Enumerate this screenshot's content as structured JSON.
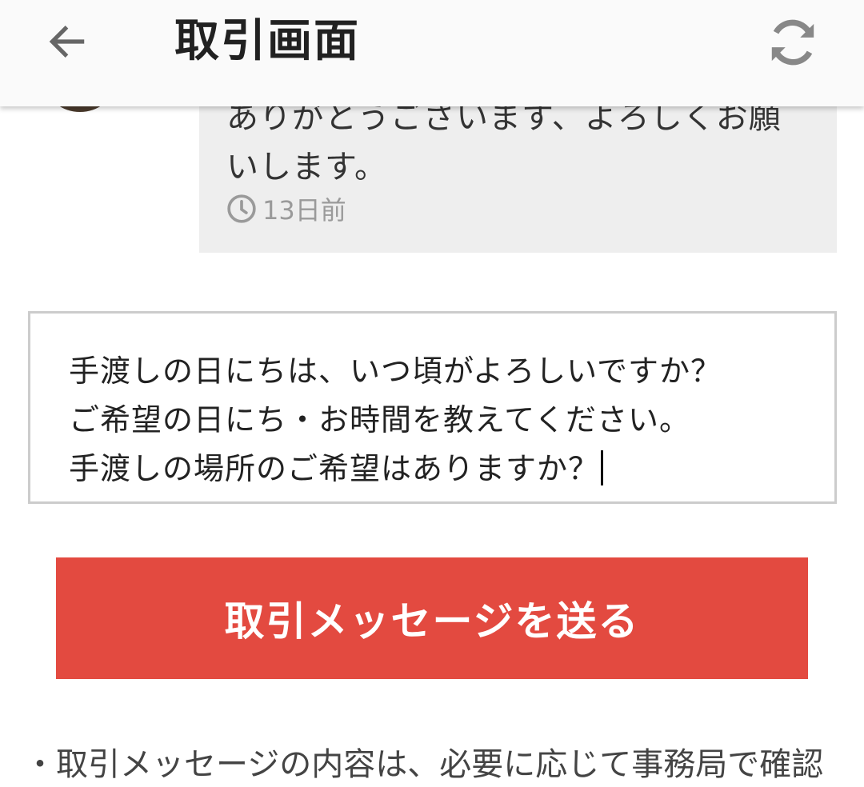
{
  "header": {
    "title": "取引画面",
    "back_icon": "arrow-left-icon",
    "refresh_icon": "refresh-icon"
  },
  "thread": {
    "messages": [
      {
        "text": "ありがとうございます、よろしくお願いします。",
        "time": "13日前",
        "time_icon": "clock-icon"
      }
    ]
  },
  "compose": {
    "value": "手渡しの日にちは、いつ頃がよろしいですか？\nご希望の日にち・お時間を教えてください。\n手渡しの場所のご希望はありますか？"
  },
  "actions": {
    "send_label": "取引メッセージを送る"
  },
  "footer": {
    "notice": "・取引メッセージの内容は、必要に応じて事務局で確認"
  },
  "colors": {
    "accent": "#e34a40",
    "app_bar_bg": "#fafafa",
    "bubble_bg": "#eeeeee",
    "muted_text": "#9a9a9a"
  }
}
